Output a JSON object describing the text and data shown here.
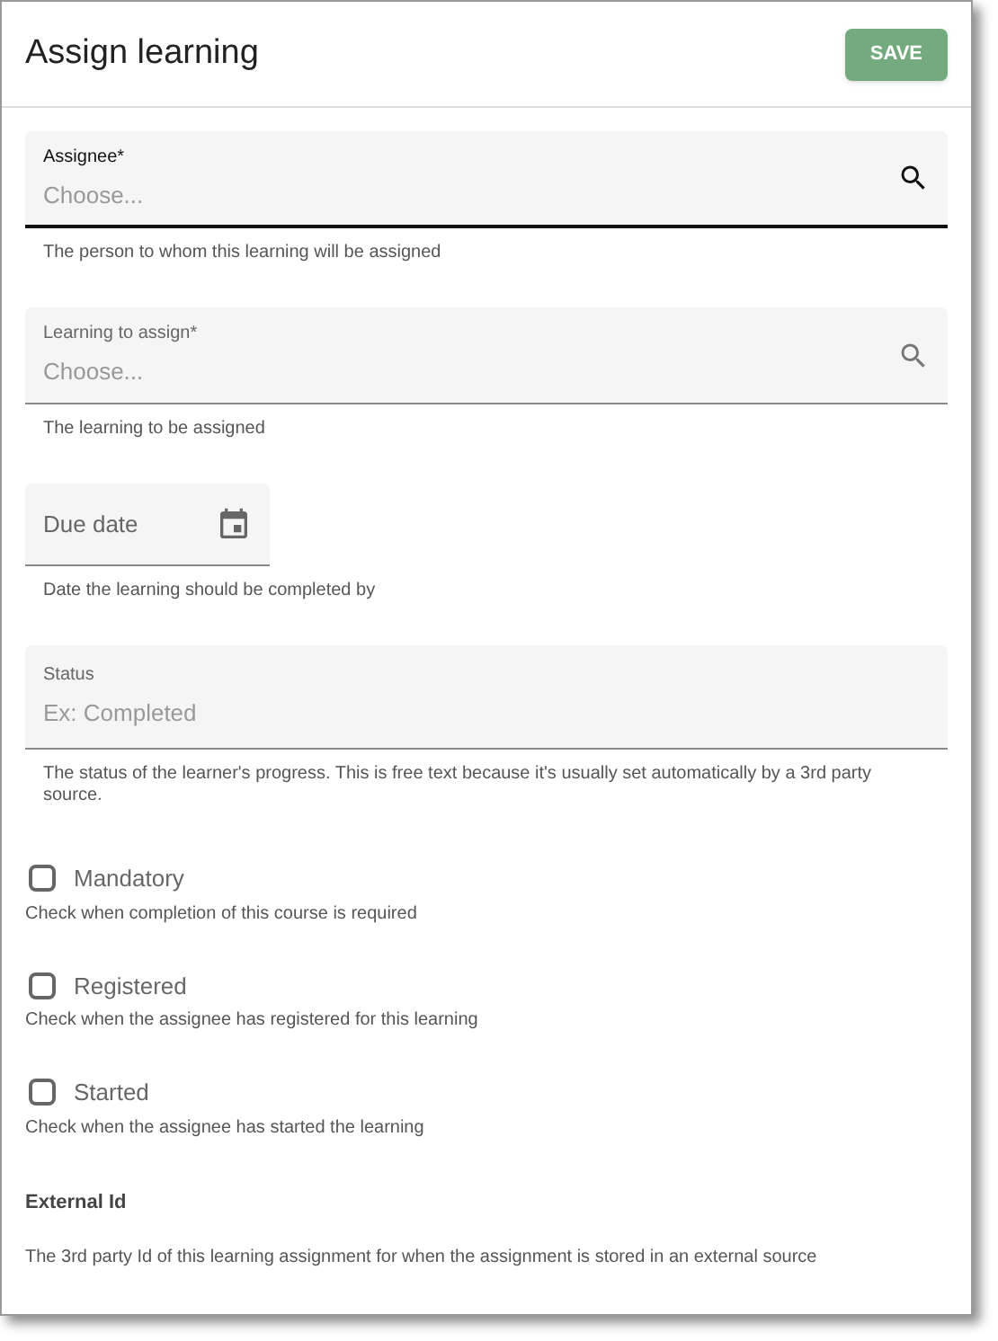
{
  "dialog": {
    "title": "Assign learning",
    "save_button": "SAVE"
  },
  "fields": [
    {
      "kind": "search",
      "label": "Assignee*",
      "placeholder": "Choose...",
      "focused": true,
      "helper": "The person to whom this learning will be assigned"
    },
    {
      "kind": "search",
      "label": "Learning to assign*",
      "placeholder": "Choose...",
      "focused": false,
      "helper": "The learning to be assigned"
    },
    {
      "kind": "date",
      "placeholder": "Due date",
      "focused": false,
      "helper": "Date the learning should be completed by"
    },
    {
      "kind": "text",
      "label": "Status",
      "placeholder": "Ex: Completed",
      "focused": false,
      "helper": "The status of the learner's progress. This is free text because it's usually set automatically by a 3rd party source."
    }
  ],
  "checkboxes": [
    {
      "label": "Mandatory",
      "checked": false,
      "helper": "Check when completion of this course is required"
    },
    {
      "label": "Registered",
      "checked": false,
      "helper": "Check when the assignee has registered for this learning"
    },
    {
      "label": "Started",
      "checked": false,
      "helper": "Check when the assignee has started the learning"
    }
  ],
  "external_id": {
    "label": "External Id",
    "helper": "The 3rd party Id of this learning assignment for when the assignment is stored in an external source"
  }
}
